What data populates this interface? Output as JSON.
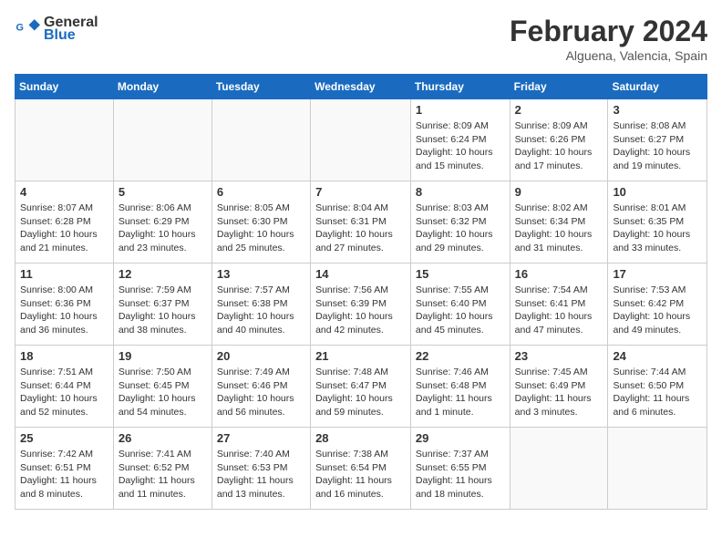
{
  "logo": {
    "line1": "General",
    "line2": "Blue"
  },
  "title": "February 2024",
  "subtitle": "Alguena, Valencia, Spain",
  "days_of_week": [
    "Sunday",
    "Monday",
    "Tuesday",
    "Wednesday",
    "Thursday",
    "Friday",
    "Saturday"
  ],
  "weeks": [
    [
      {
        "num": "",
        "info": ""
      },
      {
        "num": "",
        "info": ""
      },
      {
        "num": "",
        "info": ""
      },
      {
        "num": "",
        "info": ""
      },
      {
        "num": "1",
        "info": "Sunrise: 8:09 AM\nSunset: 6:24 PM\nDaylight: 10 hours\nand 15 minutes."
      },
      {
        "num": "2",
        "info": "Sunrise: 8:09 AM\nSunset: 6:26 PM\nDaylight: 10 hours\nand 17 minutes."
      },
      {
        "num": "3",
        "info": "Sunrise: 8:08 AM\nSunset: 6:27 PM\nDaylight: 10 hours\nand 19 minutes."
      }
    ],
    [
      {
        "num": "4",
        "info": "Sunrise: 8:07 AM\nSunset: 6:28 PM\nDaylight: 10 hours\nand 21 minutes."
      },
      {
        "num": "5",
        "info": "Sunrise: 8:06 AM\nSunset: 6:29 PM\nDaylight: 10 hours\nand 23 minutes."
      },
      {
        "num": "6",
        "info": "Sunrise: 8:05 AM\nSunset: 6:30 PM\nDaylight: 10 hours\nand 25 minutes."
      },
      {
        "num": "7",
        "info": "Sunrise: 8:04 AM\nSunset: 6:31 PM\nDaylight: 10 hours\nand 27 minutes."
      },
      {
        "num": "8",
        "info": "Sunrise: 8:03 AM\nSunset: 6:32 PM\nDaylight: 10 hours\nand 29 minutes."
      },
      {
        "num": "9",
        "info": "Sunrise: 8:02 AM\nSunset: 6:34 PM\nDaylight: 10 hours\nand 31 minutes."
      },
      {
        "num": "10",
        "info": "Sunrise: 8:01 AM\nSunset: 6:35 PM\nDaylight: 10 hours\nand 33 minutes."
      }
    ],
    [
      {
        "num": "11",
        "info": "Sunrise: 8:00 AM\nSunset: 6:36 PM\nDaylight: 10 hours\nand 36 minutes."
      },
      {
        "num": "12",
        "info": "Sunrise: 7:59 AM\nSunset: 6:37 PM\nDaylight: 10 hours\nand 38 minutes."
      },
      {
        "num": "13",
        "info": "Sunrise: 7:57 AM\nSunset: 6:38 PM\nDaylight: 10 hours\nand 40 minutes."
      },
      {
        "num": "14",
        "info": "Sunrise: 7:56 AM\nSunset: 6:39 PM\nDaylight: 10 hours\nand 42 minutes."
      },
      {
        "num": "15",
        "info": "Sunrise: 7:55 AM\nSunset: 6:40 PM\nDaylight: 10 hours\nand 45 minutes."
      },
      {
        "num": "16",
        "info": "Sunrise: 7:54 AM\nSunset: 6:41 PM\nDaylight: 10 hours\nand 47 minutes."
      },
      {
        "num": "17",
        "info": "Sunrise: 7:53 AM\nSunset: 6:42 PM\nDaylight: 10 hours\nand 49 minutes."
      }
    ],
    [
      {
        "num": "18",
        "info": "Sunrise: 7:51 AM\nSunset: 6:44 PM\nDaylight: 10 hours\nand 52 minutes."
      },
      {
        "num": "19",
        "info": "Sunrise: 7:50 AM\nSunset: 6:45 PM\nDaylight: 10 hours\nand 54 minutes."
      },
      {
        "num": "20",
        "info": "Sunrise: 7:49 AM\nSunset: 6:46 PM\nDaylight: 10 hours\nand 56 minutes."
      },
      {
        "num": "21",
        "info": "Sunrise: 7:48 AM\nSunset: 6:47 PM\nDaylight: 10 hours\nand 59 minutes."
      },
      {
        "num": "22",
        "info": "Sunrise: 7:46 AM\nSunset: 6:48 PM\nDaylight: 11 hours\nand 1 minute."
      },
      {
        "num": "23",
        "info": "Sunrise: 7:45 AM\nSunset: 6:49 PM\nDaylight: 11 hours\nand 3 minutes."
      },
      {
        "num": "24",
        "info": "Sunrise: 7:44 AM\nSunset: 6:50 PM\nDaylight: 11 hours\nand 6 minutes."
      }
    ],
    [
      {
        "num": "25",
        "info": "Sunrise: 7:42 AM\nSunset: 6:51 PM\nDaylight: 11 hours\nand 8 minutes."
      },
      {
        "num": "26",
        "info": "Sunrise: 7:41 AM\nSunset: 6:52 PM\nDaylight: 11 hours\nand 11 minutes."
      },
      {
        "num": "27",
        "info": "Sunrise: 7:40 AM\nSunset: 6:53 PM\nDaylight: 11 hours\nand 13 minutes."
      },
      {
        "num": "28",
        "info": "Sunrise: 7:38 AM\nSunset: 6:54 PM\nDaylight: 11 hours\nand 16 minutes."
      },
      {
        "num": "29",
        "info": "Sunrise: 7:37 AM\nSunset: 6:55 PM\nDaylight: 11 hours\nand 18 minutes."
      },
      {
        "num": "",
        "info": ""
      },
      {
        "num": "",
        "info": ""
      }
    ]
  ]
}
